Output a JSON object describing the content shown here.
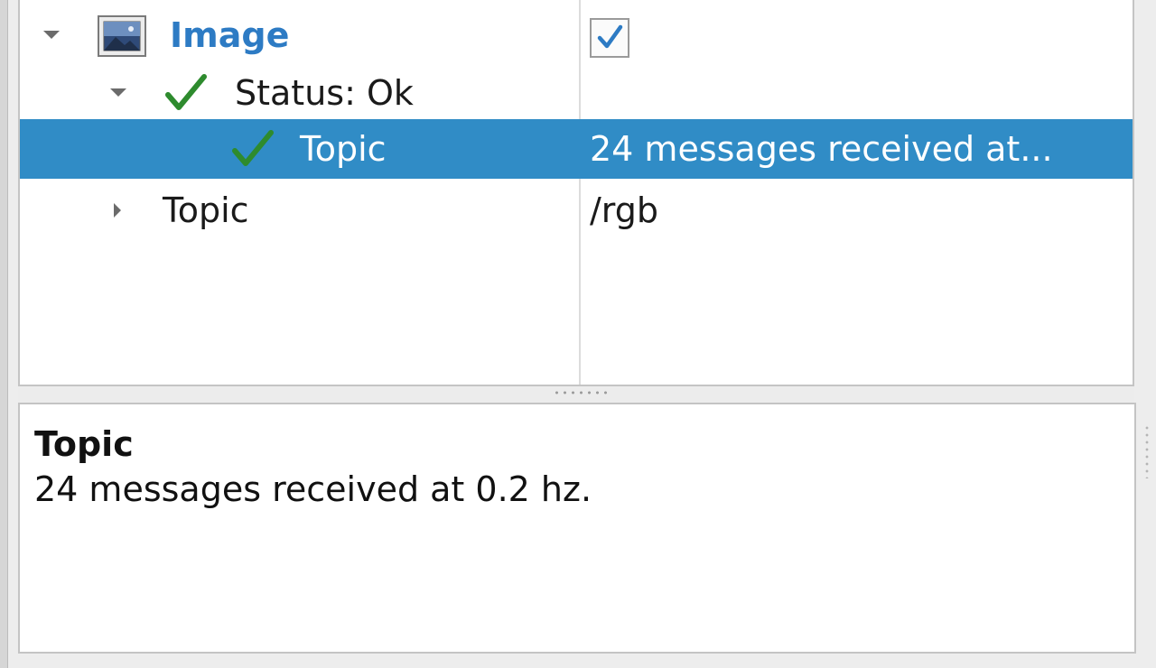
{
  "tree": {
    "rows": [
      {
        "label": "Image",
        "value_checked": true
      },
      {
        "label": "Status: Ok"
      },
      {
        "label": "Topic",
        "value": "24 messages received at..."
      },
      {
        "label": "Topic",
        "value": "/rgb"
      }
    ]
  },
  "detail": {
    "title": "Topic",
    "body": "24 messages received at 0.2 hz."
  },
  "colors": {
    "selection": "#308cc6",
    "accent_blue": "#2d7bc4",
    "status_ok_green": "#2e8b2e"
  },
  "icons": {
    "image": "image-icon",
    "status": "checkmark-icon",
    "expand": "chevron-down-icon",
    "collapse": "chevron-right-icon"
  }
}
